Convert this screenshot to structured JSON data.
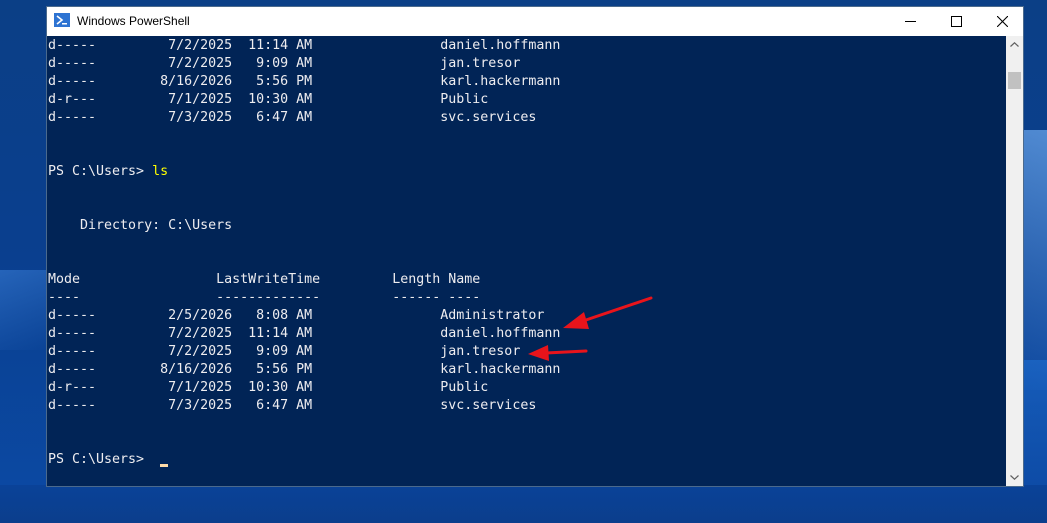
{
  "window": {
    "title": "Windows PowerShell",
    "icon": "powershell-icon",
    "controls": {
      "minimize": "minimize-icon",
      "maximize": "maximize-icon",
      "close": "close-icon"
    }
  },
  "console": {
    "colors": {
      "background": "#012456",
      "text": "#eeedf0",
      "command": "#ffff00",
      "cursor": "#fedba9"
    },
    "lines": [
      {
        "text": "d-----         7/2/2025  11:14 AM                daniel.hoffmann"
      },
      {
        "text": "d-----         7/2/2025   9:09 AM                jan.tresor"
      },
      {
        "text": "d-----        8/16/2026   5:56 PM                karl.hackermann"
      },
      {
        "text": "d-r---         7/1/2025  10:30 AM                Public"
      },
      {
        "text": "d-----         7/3/2025   6:47 AM                svc.services"
      },
      {
        "text": ""
      },
      {
        "text": ""
      },
      {
        "text": "PS C:\\Users> ",
        "cmd": "ls"
      },
      {
        "text": ""
      },
      {
        "text": ""
      },
      {
        "text": "    Directory: C:\\Users"
      },
      {
        "text": ""
      },
      {
        "text": ""
      },
      {
        "text": "Mode                 LastWriteTime         Length Name"
      },
      {
        "text": "----                 -------------         ------ ----"
      },
      {
        "text": "d-----         2/5/2026   8:08 AM                Administrator"
      },
      {
        "text": "d-----         7/2/2025  11:14 AM                daniel.hoffmann"
      },
      {
        "text": "d-----         7/2/2025   9:09 AM                jan.tresor"
      },
      {
        "text": "d-----        8/16/2026   5:56 PM                karl.hackermann"
      },
      {
        "text": "d-r---         7/1/2025  10:30 AM                Public"
      },
      {
        "text": "d-----         7/3/2025   6:47 AM                svc.services"
      },
      {
        "text": ""
      },
      {
        "text": ""
      },
      {
        "text": "PS C:\\Users> ",
        "cursor": true
      }
    ]
  },
  "annotations": {
    "arrow_color": "#e8141b"
  }
}
